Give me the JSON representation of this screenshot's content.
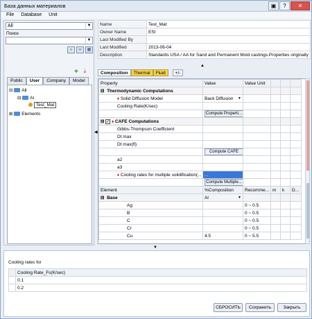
{
  "window": {
    "title": "База данных материалов"
  },
  "menu": [
    "File",
    "Database",
    "Unit"
  ],
  "left": {
    "filter_value": "All",
    "search_label": "Поиск",
    "tabs": [
      "Public",
      "User",
      "Company",
      "Model"
    ],
    "tree": {
      "root": "All",
      "child": "Al",
      "leaf": "Test_Mat",
      "elements": "Elements"
    }
  },
  "info": {
    "rows": [
      {
        "k": "Name",
        "v": "Test_Mat"
      },
      {
        "k": "Owner Name",
        "v": "ESI"
      },
      {
        "k": "Last Modified By",
        "v": ""
      },
      {
        "k": "Last Modified",
        "v": "2013-06-04"
      },
      {
        "k": "Description",
        "v": "Standards USA / AA for Sand and Permanent Mold castings.Properties originally co..."
      }
    ]
  },
  "rtabs": [
    "Composition",
    "Thermal",
    "Fluid",
    "+/-"
  ],
  "grid": {
    "header": [
      "Property",
      "Value",
      "Value Unit"
    ],
    "thermo_title": "Thermodynamic Computations",
    "solid_diff": {
      "label": "Solid Diffusion Model",
      "value": "Back Diffusion"
    },
    "cooling_rate": "Cooling Rate(K/sec)",
    "compute_props": "Compute Properti...",
    "cafe_title": "CAFE Computations",
    "cafe_rows": [
      "Gibbs-Thompson Coefficient",
      "Dt max",
      "Dt max(fl)"
    ],
    "compute_cafe": "Compute CAFE",
    "a_rows": [
      "a2",
      "a3"
    ],
    "cooling_multi": "Cooling rates for multiple solidification(...",
    "cooling_multi_value": "...",
    "compute_multi": "Compute Multiple...",
    "elem_header": [
      "Element",
      "%Composition",
      "Recomme...",
      "m",
      "k",
      "D..."
    ],
    "base_label": "Base",
    "base_value": "Al",
    "elements": [
      {
        "name": "Ag",
        "comp": "",
        "rec": "0 ~ 0.5"
      },
      {
        "name": "B",
        "comp": "",
        "rec": "0 ~ 0.5"
      },
      {
        "name": "C",
        "comp": "",
        "rec": "0 ~ 0.5"
      },
      {
        "name": "Cr",
        "comp": "",
        "rec": "0 ~ 0.5"
      },
      {
        "name": "Cu",
        "comp": "4.5",
        "rec": "0 ~ 5.5"
      }
    ]
  },
  "bottom": {
    "title": "Cooling rates for",
    "col": "Cooling Rate_Fs(K/sec)",
    "rows": [
      "0.1",
      "0.2"
    ]
  },
  "buttons": {
    "reset": "СБРОСИТЬ",
    "save": "Сохранить",
    "close": "Закрыть"
  }
}
